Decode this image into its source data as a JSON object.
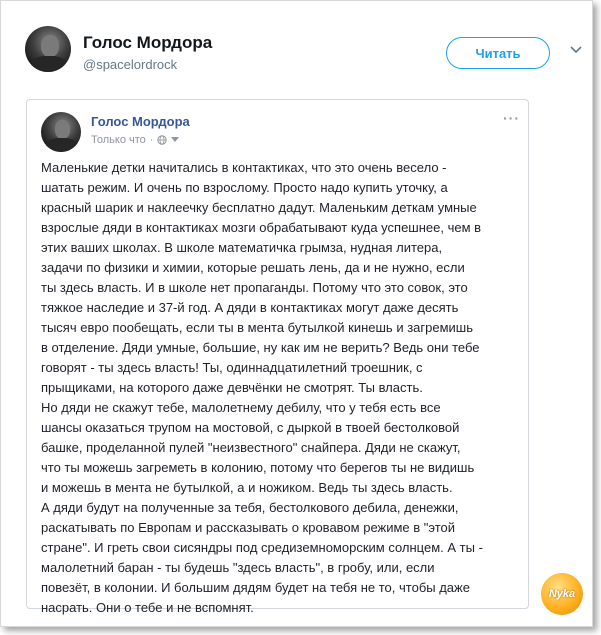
{
  "tweet": {
    "author_name": "Голос Мордора",
    "author_handle": "@spacelordrock",
    "follow_label": "Читать"
  },
  "post": {
    "author_name": "Голос Мордора",
    "time": "Только что",
    "more": "···",
    "text": "Маленькие детки начитались в контактиках, что это очень весело -\nшатать режим. И очень по взрослому. Просто надо купить уточку, а\nкрасный шарик и наклеечку бесплатно дадут. Маленьким деткам умные\nвзрослые дяди в контактиках мозги обрабатывают куда успешнее, чем в\nэтих ваших школах. В школе математичка грымза, нудная литера,\nзадачи по физики и химии, которые решать лень, да и не нужно, если\nты здесь власть. И в школе нет пропаганды. Потому что это совок, это\nтяжкое наследие и 37-й год. А дяди в контактиках могут даже десять\nтысяч евро пообещать, если ты в мента бутылкой кинешь и загремишь\nв отделение. Дяди умные, большие, ну как им не верить? Ведь они тебе\nговорят - ты здесь власть! Ты, одиннадцатилетний троешник, с\nпрыщиками, на которого даже девчёнки не смотрят. Ты власть.\nНо дяди не скажут тебе, малолетнему дебилу, что у тебя есть все\nшансы оказаться трупом на мостовой, с дыркой в твоей бестолковой\nбашке, проделанной пулей \"неизвестного\" снайпера. Дяди не скажут,\nчто ты можешь загреметь в колонию, потому что берегов ты не видишь\nи можешь в мента не бутылкой, а и ножиком. Ведь ты здесь власть.\nА дяди будут на полученные за тебя, бестолкового дебила, денежки,\nраскатывать по Европам и рассказывать о кровавом режиме в \"этой\nстране\". И греть свои сисяндры под средиземноморским солнцем. А ты -\nмалолетний баран - ты будешь \"здесь власть\", в гробу, или, если\nповезёт, в колонии. И большим дядям будет на тебя не то, чтобы даже\nнасрать. Они о тебе и не вспомнят."
  },
  "watermark": {
    "text": "Nyka"
  },
  "colors": {
    "twitter_blue": "#1da1f2",
    "fb_link_blue": "#365899",
    "watermark_orange": "#ffb020"
  }
}
